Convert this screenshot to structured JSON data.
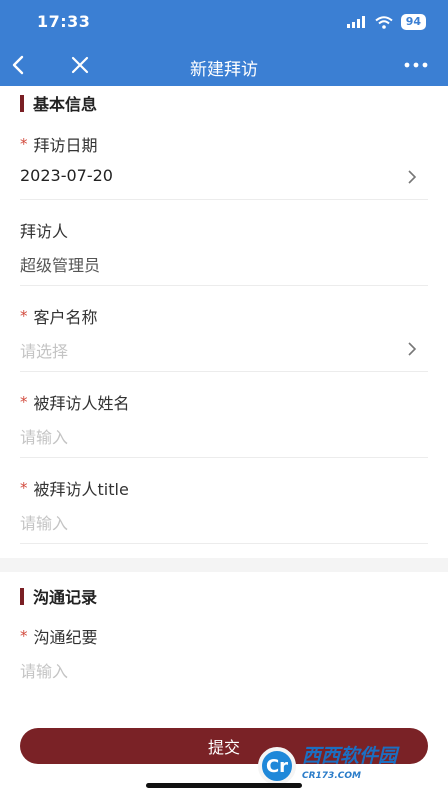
{
  "status_bar": {
    "time": "17:33",
    "battery": "94",
    "icons": [
      "signal-icon",
      "wifi-icon",
      "battery-icon"
    ]
  },
  "nav": {
    "title": "新建拜访",
    "back_icon": "chevron-left-icon",
    "close_icon": "close-icon",
    "more_icon": "more-icon"
  },
  "sections": {
    "basic": {
      "title": "基本信息"
    },
    "communication": {
      "title": "沟通记录"
    }
  },
  "fields": {
    "visit_date": {
      "required": "*",
      "label": "拜访日期",
      "value": "2023-07-20"
    },
    "visitor": {
      "label": "拜访人",
      "value": "超级管理员"
    },
    "customer_name": {
      "required": "*",
      "label": "客户名称",
      "placeholder": "请选择"
    },
    "visitee_name": {
      "required": "*",
      "label": "被拜访人姓名",
      "placeholder": "请输入"
    },
    "visitee_title": {
      "required": "*",
      "label": "被拜访人title",
      "placeholder": "请输入"
    },
    "summary": {
      "required": "*",
      "label": "沟通纪要",
      "placeholder": "请输入"
    }
  },
  "submit_label": "提交",
  "watermark": {
    "text": "西西软件园",
    "sub": "CR173.COM",
    "logo": "Cr"
  },
  "colors": {
    "header": "#3b7fd3",
    "accent": "#7a2226",
    "required": "#d24b3e"
  }
}
